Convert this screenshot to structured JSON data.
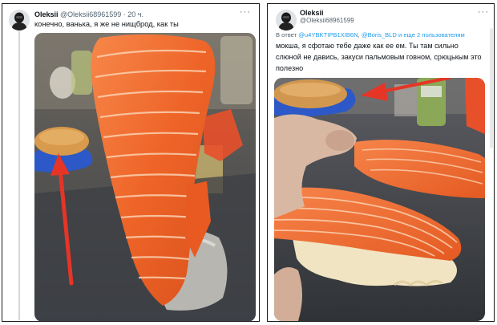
{
  "left_tweet": {
    "author_name": "Oleksii",
    "author_handle": "@Oleksii68961599",
    "separator": "·",
    "time": "20 ч.",
    "text": "конечно, ванька, я же не нищброд, как ты"
  },
  "right_tweet": {
    "author_name": "Oleksii",
    "author_handle": "@Oleksii68961599",
    "reply_prefix": "В ответ ",
    "reply_user_1": "@u4YBKTIPB1XIB6N",
    "reply_sep": ", ",
    "reply_user_2": "@Boris_BLD",
    "reply_suffix": " и еще 2 пользователям",
    "text": "мокша, я сфотаю тебе даже как ее ем. Ты там сильно слюной не давись, закуси пальмовым говном, срюцькым это полезно"
  },
  "icons": {
    "avatar": "avatar-icon",
    "more": "more-icon",
    "arrow": "red-arrow-icon"
  },
  "colors": {
    "link": "#1d9bf0",
    "secondary_text": "#536471",
    "arrow": "#e53527",
    "salmon": "#ef6a2a"
  }
}
